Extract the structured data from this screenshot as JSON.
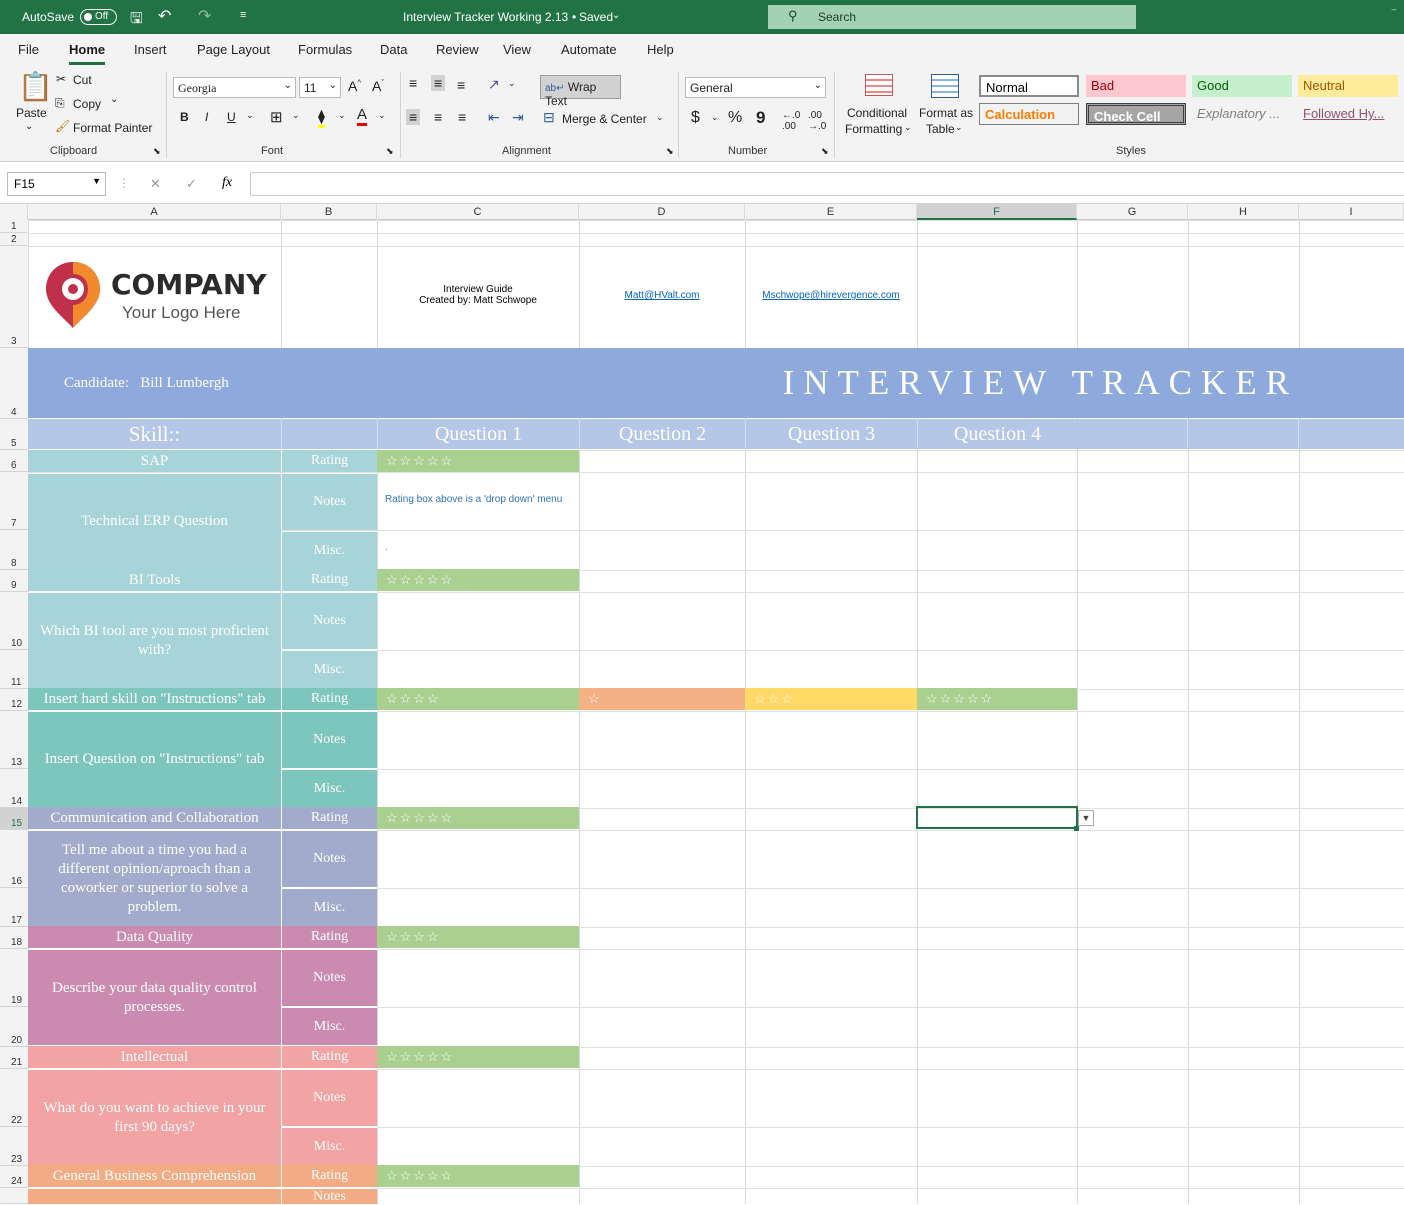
{
  "titlebar": {
    "autosave_label": "AutoSave",
    "autosave_state": "Off",
    "doc_title": "Interview Tracker Working 2.13",
    "saved_status": "Saved",
    "search_placeholder": "Search"
  },
  "tabs": [
    "File",
    "Home",
    "Insert",
    "Page Layout",
    "Formulas",
    "Data",
    "Review",
    "View",
    "Automate",
    "Help"
  ],
  "ribbon": {
    "clipboard": {
      "paste": "Paste",
      "cut": "Cut",
      "copy": "Copy",
      "format_painter": "Format Painter",
      "group": "Clipboard"
    },
    "font": {
      "name": "Georgia",
      "size": "11",
      "group": "Font",
      "bold": "B",
      "italic": "I",
      "underline": "U"
    },
    "alignment": {
      "wrap_text": "Wrap Text",
      "merge_center": "Merge & Center",
      "group": "Alignment"
    },
    "number": {
      "format": "General",
      "currency": "$",
      "percent": "%",
      "comma": "9",
      "group": "Number"
    },
    "styles": {
      "conditional_line1": "Conditional",
      "conditional_line2": "Formatting",
      "table_line1": "Format as",
      "table_line2": "Table",
      "group": "Styles",
      "cells": [
        {
          "label": "Normal"
        },
        {
          "label": "Bad"
        },
        {
          "label": "Good"
        },
        {
          "label": "Neutral"
        },
        {
          "label": "Calculation"
        },
        {
          "label": "Check Cell"
        },
        {
          "label": "Explanatory ..."
        },
        {
          "label": "Followed Hy..."
        }
      ]
    }
  },
  "formula_bar": {
    "name_box": "F15",
    "fx": "fx",
    "cancel": "✕",
    "enter": "✓"
  },
  "columns": [
    "A",
    "B",
    "C",
    "D",
    "E",
    "F",
    "G",
    "H",
    "I"
  ],
  "rows": [
    "1",
    "2",
    "3",
    "4",
    "5",
    "6",
    "7",
    "8",
    "9",
    "10",
    "11",
    "12",
    "13",
    "14",
    "15",
    "16",
    "17",
    "18",
    "19",
    "20",
    "21",
    "22",
    "23",
    "24"
  ],
  "sheet": {
    "logo_company": "COMPANY",
    "logo_sub": "Your Logo Here",
    "guide_line1": "Interview Guide",
    "guide_line2": "Created by: Matt Schwope",
    "email1": "Matt@HValt.com",
    "email2": "Mschwope@hirevergence.com",
    "candidate_label": "Candidate:",
    "candidate_name": "Bill Lumbergh",
    "banner": "INTERVIEW TRACKER",
    "skill_header": "Skill::",
    "question_headers": [
      "Question 1",
      "Question 2",
      "Question 3",
      "Question 4"
    ],
    "rating_label": "Rating",
    "notes_label": "Notes",
    "misc_label": "Misc.",
    "note_hint": "Rating box above is a 'drop down' menu",
    "misc_dot": ".",
    "skills": [
      {
        "name": "SAP",
        "question": "Technical ERP Question",
        "color": "#a7d4d9",
        "ratings": [
          "☆☆☆☆☆",
          "",
          "",
          ""
        ]
      },
      {
        "name": "BI Tools",
        "question": "Which BI tool are you most proficient with?",
        "color": "#a7d4d9",
        "ratings": [
          "☆☆☆☆☆",
          "",
          "",
          ""
        ]
      },
      {
        "name": "Insert hard skill on \"Instructions\" tab",
        "question": "Insert Question on \"Instructions\" tab",
        "color": "#7dc6bd",
        "ratings": [
          "☆☆☆☆",
          "☆",
          "☆☆☆",
          "☆☆☆☆☆"
        ]
      },
      {
        "name": "Communication and Collaboration",
        "question": "Tell me about a time you had a different opinion/aproach than a coworker or superior to solve a problem.",
        "color": "#a3abcd",
        "ratings": [
          "☆☆☆☆☆",
          "",
          "",
          ""
        ]
      },
      {
        "name": "Data Quality",
        "question": "Describe your data quality control processes.",
        "color": "#cb8bb1",
        "ratings": [
          "☆☆☆☆",
          "",
          "",
          ""
        ]
      },
      {
        "name": "Intellectual",
        "question": "What do you want to achieve in your first 90 days?",
        "color": "#f2a3a3",
        "ratings": [
          "☆☆☆☆☆",
          "",
          "",
          ""
        ]
      },
      {
        "name": "General Business Comprehension",
        "question": "",
        "color": "#f2ab83",
        "ratings": [
          "☆☆☆☆☆",
          "",
          "",
          ""
        ]
      }
    ],
    "rating_colors": [
      "#a9d08e",
      "#f4b183",
      "#ffd966",
      "#a9d08e"
    ]
  }
}
